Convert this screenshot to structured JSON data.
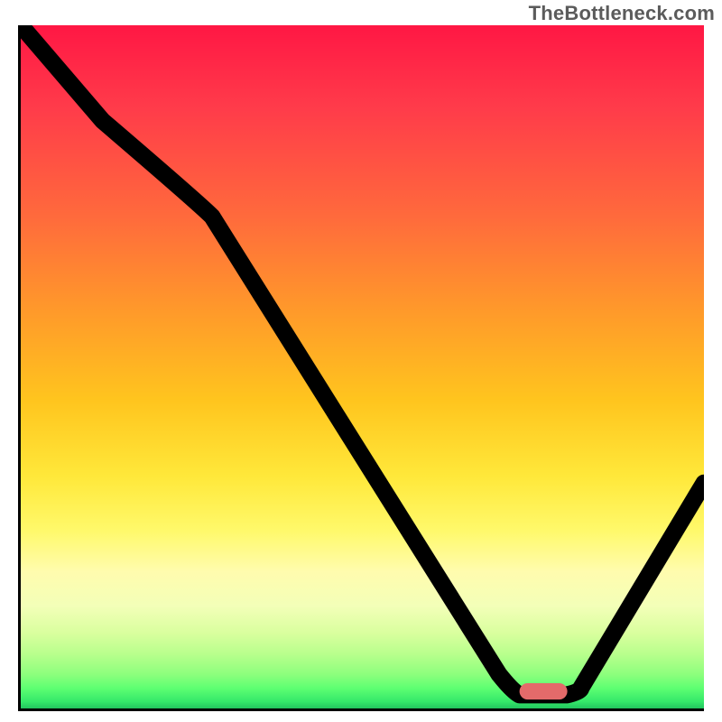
{
  "watermark": "TheBottleneck.com",
  "chart_data": {
    "type": "line",
    "title": "",
    "xlabel": "",
    "ylabel": "",
    "xlim": [
      0,
      100
    ],
    "ylim": [
      0,
      100
    ],
    "grid": false,
    "legend": false,
    "series": [
      {
        "name": "bottleneck-curve",
        "x": [
          0,
          12,
          28,
          70,
          73,
          80,
          82,
          100
        ],
        "y": [
          100,
          86,
          72,
          5,
          2,
          2,
          3,
          33
        ]
      }
    ],
    "marker": {
      "name": "optimal-range",
      "shape": "pill",
      "x_center": 76.5,
      "y": 2,
      "width": 7,
      "color": "#e46a6a"
    },
    "background_gradient": {
      "stops": [
        {
          "pos": 0.0,
          "color": "#ff1744"
        },
        {
          "pos": 0.28,
          "color": "#ff6a3c"
        },
        {
          "pos": 0.55,
          "color": "#ffc51e"
        },
        {
          "pos": 0.74,
          "color": "#fff96b"
        },
        {
          "pos": 0.89,
          "color": "#d9ff9e"
        },
        {
          "pos": 1.0,
          "color": "#22c55e"
        }
      ]
    }
  }
}
